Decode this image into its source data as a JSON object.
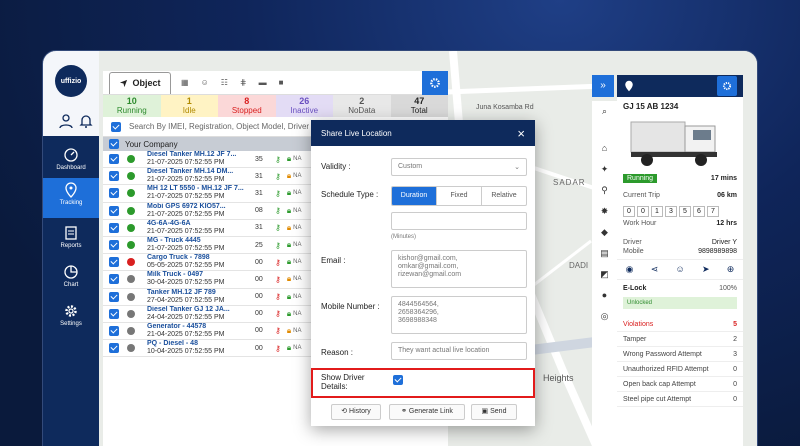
{
  "app": {
    "logo_text": "uffizio"
  },
  "sidebar": {
    "items": [
      {
        "label": "Dashboard"
      },
      {
        "label": "Tracking"
      },
      {
        "label": "Reports"
      },
      {
        "label": "Chart"
      },
      {
        "label": "Settings"
      }
    ]
  },
  "panel": {
    "tab_label": "Object",
    "statuses": [
      {
        "count": "10",
        "label": "Running",
        "bg": "#dff2d9",
        "color": "#2c8a2c"
      },
      {
        "count": "1",
        "label": "Idle",
        "bg": "#fff3c4",
        "color": "#b08a00"
      },
      {
        "count": "8",
        "label": "Stopped",
        "bg": "#fbd8d8",
        "color": "#d92020"
      },
      {
        "count": "26",
        "label": "Inactive",
        "bg": "#e3dcf5",
        "color": "#6a4fc0"
      },
      {
        "count": "2",
        "label": "NoData",
        "bg": "#e8e8e8",
        "color": "#555"
      },
      {
        "count": "47",
        "label": "Total",
        "bg": "#d9d9d9",
        "color": "#222"
      }
    ],
    "search_placeholder": "Search By IMEI, Registration, Object Model, Driver",
    "company": "Your Company",
    "rows": [
      {
        "name": "Diesel Tanker MH.12 JF 7...",
        "time": "21-07-2025 07:52:55 PM",
        "speed": "35",
        "dot": "#2c9a2c"
      },
      {
        "name": "Diesel Tanker MH.14 DM...",
        "time": "21-07-2025 07:52:55 PM",
        "speed": "31",
        "dot": "#2c9a2c"
      },
      {
        "name": "MH 12 LT 5550 - MH.12 JF 7...",
        "time": "21-07-2025 07:52:55 PM",
        "speed": "31",
        "dot": "#2c9a2c"
      },
      {
        "name": "Mobi GPS 6972 KIO57...",
        "time": "21-07-2025 07:52:55 PM",
        "speed": "08",
        "dot": "#2c9a2c"
      },
      {
        "name": "4G-6A-4G-6A",
        "time": "21-07-2025 07:52:55 PM",
        "speed": "31",
        "dot": "#2c9a2c"
      },
      {
        "name": "MG - Truck 4445",
        "time": "21-07-2025 07:52:55 PM",
        "speed": "25",
        "dot": "#2c9a2c"
      },
      {
        "name": "Cargo Truck - 7898",
        "time": "05-05-2025 07:52:55 PM",
        "speed": "00",
        "dot": "#d92020"
      },
      {
        "name": "Milk Truck - 0497",
        "time": "30-04-2025 07:52:55 PM",
        "speed": "00",
        "dot": "#777"
      },
      {
        "name": "Tanker MH.12 JF 789",
        "time": "27-04-2025 07:52:55 PM",
        "speed": "00",
        "dot": "#777"
      },
      {
        "name": "Diesel Tanker GJ 12 JA...",
        "time": "24-04-2025 07:52:55 PM",
        "speed": "00",
        "dot": "#777"
      },
      {
        "name": "Generator - 44578",
        "time": "21-04-2025 07:52:55 PM",
        "speed": "00",
        "dot": "#777"
      },
      {
        "name": "PQ - Diesel - 48",
        "time": "10-04-2025 07:52:55 PM",
        "speed": "00",
        "dot": "#777"
      }
    ],
    "na": "NA"
  },
  "map": {
    "labels": [
      "Juna Kosamba Rd",
      "SADAR",
      "DADI",
      "Heights"
    ]
  },
  "modal": {
    "title": "Share Live Location",
    "validity_label": "Validity :",
    "validity_value": "Custom",
    "schedule_label": "Schedule Type :",
    "schedule_options": [
      "Duration",
      "Fixed",
      "Relative"
    ],
    "minutes_hint": "(Minutes)",
    "email_label": "Email :",
    "email_value": "kishor@gmail.com,\nomkar@gmail.com,\nrizewan@gmail.com",
    "mobile_label": "Mobile Number :",
    "mobile_value": "4844564564,\n2658364296,\n3698988348",
    "reason_label": "Reason :",
    "reason_placeholder": "They want actual live location",
    "show_driver_label": "Show Driver\nDetails:",
    "buttons": {
      "history": "History",
      "generate": "Generate Link",
      "send": "Send"
    }
  },
  "right": {
    "vehicle": "GJ 15 AB 1234",
    "status": "Running",
    "status_time": "17 mins",
    "current_trip_label": "Current Trip",
    "current_trip": "06 km",
    "odometer": [
      "0",
      "0",
      "1",
      "3",
      "5",
      "6",
      "7"
    ],
    "work_hour_label": "Work Hour",
    "work_hour": "12 hrs",
    "driver_label": "Driver",
    "driver": "Driver Y",
    "mobile_label": "Mobile",
    "mobile": "9898989898",
    "elock_title": "E-Lock",
    "elock_pct": "100%",
    "elock_status": "Unlocked",
    "violations_label": "Violations",
    "violations": "5",
    "elock_rows": [
      {
        "label": "Tamper",
        "value": "2"
      },
      {
        "label": "Wrong Password Attempt",
        "value": "3"
      },
      {
        "label": "Unauthorized RFID Attempt",
        "value": "0"
      },
      {
        "label": "Open back cap Attempt",
        "value": "0"
      },
      {
        "label": "Steel pipe cut Attempt",
        "value": "0"
      }
    ]
  }
}
